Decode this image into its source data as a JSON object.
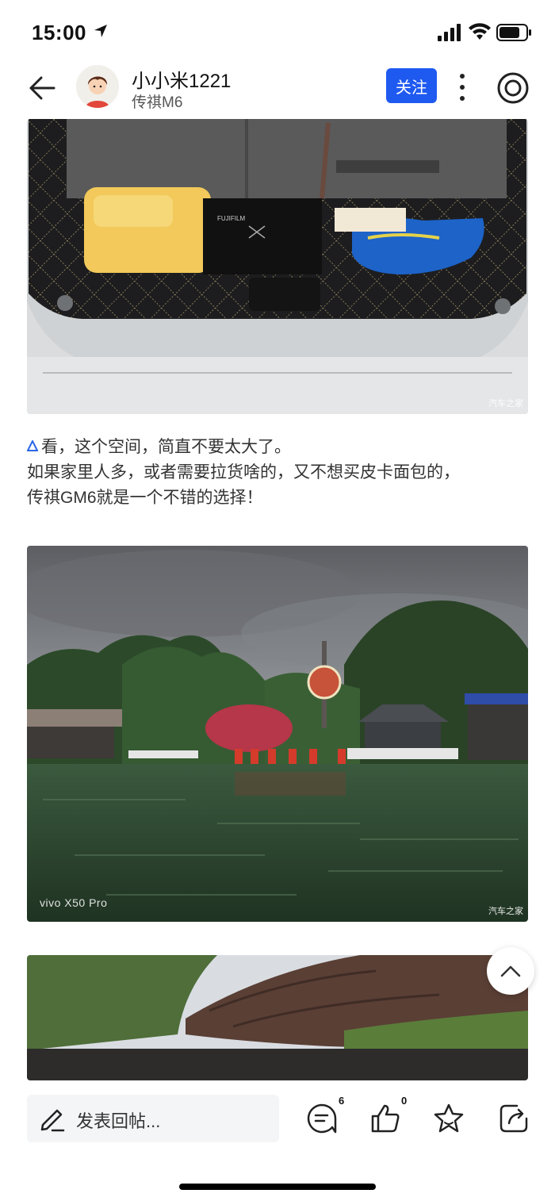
{
  "status_bar": {
    "time": "15:00"
  },
  "header": {
    "username": "小小米1221",
    "subtitle": "传祺M6",
    "follow_label": "关注"
  },
  "post": {
    "line1": "看，这个空间，简直不要太大了。",
    "line2": "如果家里人多，或者需要拉货啥的，又不想买皮卡面包的，",
    "line3": "传祺GM6就是一个不错的选择！"
  },
  "images": {
    "watermark": "汽车之家",
    "camera_label": "vivo X50 Pro"
  },
  "toolbar": {
    "reply_placeholder": "发表回帖...",
    "comment_count": "6",
    "like_count": "0"
  },
  "icons": [
    "back-arrow-icon",
    "more-vertical-icon",
    "record-icon",
    "chevron-up-icon",
    "pencil-icon",
    "comment-icon",
    "thumbs-up-icon",
    "star-icon",
    "share-icon"
  ],
  "colors": {
    "accent": "#1f5af0"
  }
}
